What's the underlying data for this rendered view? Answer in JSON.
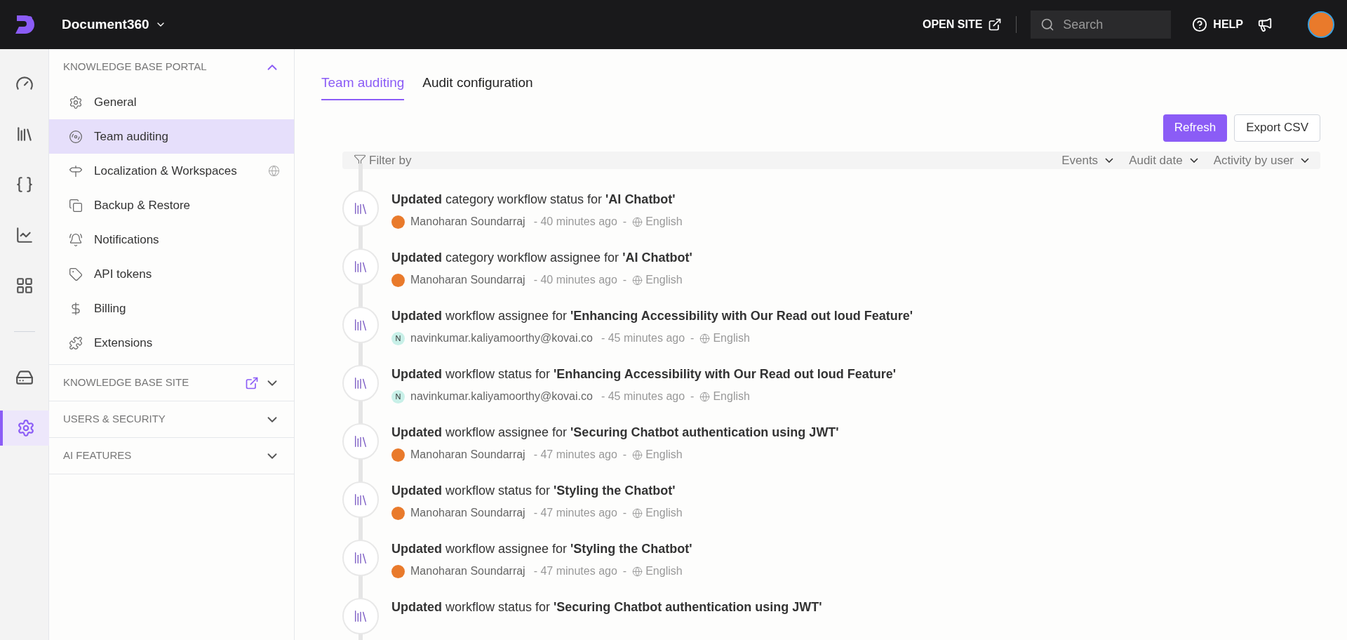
{
  "topbar": {
    "project": "Document360",
    "open_site": "OPEN SITE",
    "search": {
      "placeholder": "Search"
    },
    "help": "HELP"
  },
  "rail": [
    {
      "kind": "gauge",
      "selected": false
    },
    {
      "kind": "books",
      "selected": false
    },
    {
      "kind": "api",
      "selected": false
    },
    {
      "kind": "analytics",
      "selected": false
    },
    {
      "kind": "apps",
      "selected": false
    },
    {
      "kind": "divider"
    },
    {
      "kind": "drive",
      "selected": false
    },
    {
      "kind": "settings",
      "selected": true
    }
  ],
  "sidebar": {
    "sections": [
      {
        "title": "KNOWLEDGE BASE PORTAL",
        "expanded": true,
        "external": false,
        "items": [
          {
            "label": "General",
            "selected": false,
            "globe": false
          },
          {
            "label": "Team auditing",
            "selected": true,
            "globe": false
          },
          {
            "label": "Localization & Workspaces",
            "selected": false,
            "globe": true
          },
          {
            "label": "Backup & Restore",
            "selected": false,
            "globe": false
          },
          {
            "label": "Notifications",
            "selected": false,
            "globe": false
          },
          {
            "label": "API tokens",
            "selected": false,
            "globe": false
          },
          {
            "label": "Billing",
            "selected": false,
            "globe": false
          },
          {
            "label": "Extensions",
            "selected": false,
            "globe": false
          }
        ]
      },
      {
        "title": "KNOWLEDGE BASE SITE",
        "expanded": false,
        "external": true
      },
      {
        "title": "USERS & SECURITY",
        "expanded": false,
        "external": false
      },
      {
        "title": "AI FEATURES",
        "expanded": false,
        "external": false
      }
    ]
  },
  "tabs": [
    {
      "label": "Team auditing",
      "selected": true
    },
    {
      "label": "Audit configuration",
      "selected": false
    }
  ],
  "buttons": {
    "refresh": "Refresh",
    "export": "Export CSV"
  },
  "filter": {
    "label": "Filter by",
    "dropdowns": [
      "Events",
      "Audit date",
      "Activity by user"
    ]
  },
  "events": [
    {
      "title": "**Updated** category workflow status for **'AI Chatbot'**",
      "avatar": {
        "kind": "photo"
      },
      "user": "Manoharan Soundarraj",
      "time": "- 40 minutes ago",
      "separator": "-",
      "language": "English"
    },
    {
      "title": "**Updated** category workflow assignee for **'AI Chatbot'**",
      "avatar": {
        "kind": "photo"
      },
      "user": "Manoharan Soundarraj",
      "time": "- 40 minutes ago",
      "separator": "-",
      "language": "English"
    },
    {
      "title": "**Updated** workflow assignee for **'Enhancing Accessibility with Our Read out loud Feature'**",
      "avatar": {
        "kind": "initial",
        "initial": "N"
      },
      "user": "navinkumar.kaliyamoorthy@kovai.co",
      "time": "- 45 minutes ago",
      "separator": "-",
      "language": "English"
    },
    {
      "title": "**Updated** workflow status for **'Enhancing Accessibility with Our Read out loud Feature'**",
      "avatar": {
        "kind": "initial",
        "initial": "N"
      },
      "user": "navinkumar.kaliyamoorthy@kovai.co",
      "time": "- 45 minutes ago",
      "separator": "-",
      "language": "English"
    },
    {
      "title": "**Updated** workflow assignee for **'Securing Chatbot authentication using JWT'**",
      "avatar": {
        "kind": "photo"
      },
      "user": "Manoharan Soundarraj",
      "time": "- 47 minutes ago",
      "separator": "-",
      "language": "English"
    },
    {
      "title": "**Updated** workflow status for **'Styling the Chatbot'**",
      "avatar": {
        "kind": "photo"
      },
      "user": "Manoharan Soundarraj",
      "time": "- 47 minutes ago",
      "separator": "-",
      "language": "English"
    },
    {
      "title": "**Updated** workflow assignee for **'Styling the Chatbot'**",
      "avatar": {
        "kind": "photo"
      },
      "user": "Manoharan Soundarraj",
      "time": "- 47 minutes ago",
      "separator": "-",
      "language": "English"
    },
    {
      "title": "**Updated** workflow status for **'Securing Chatbot authentication using JWT'**"
    }
  ]
}
